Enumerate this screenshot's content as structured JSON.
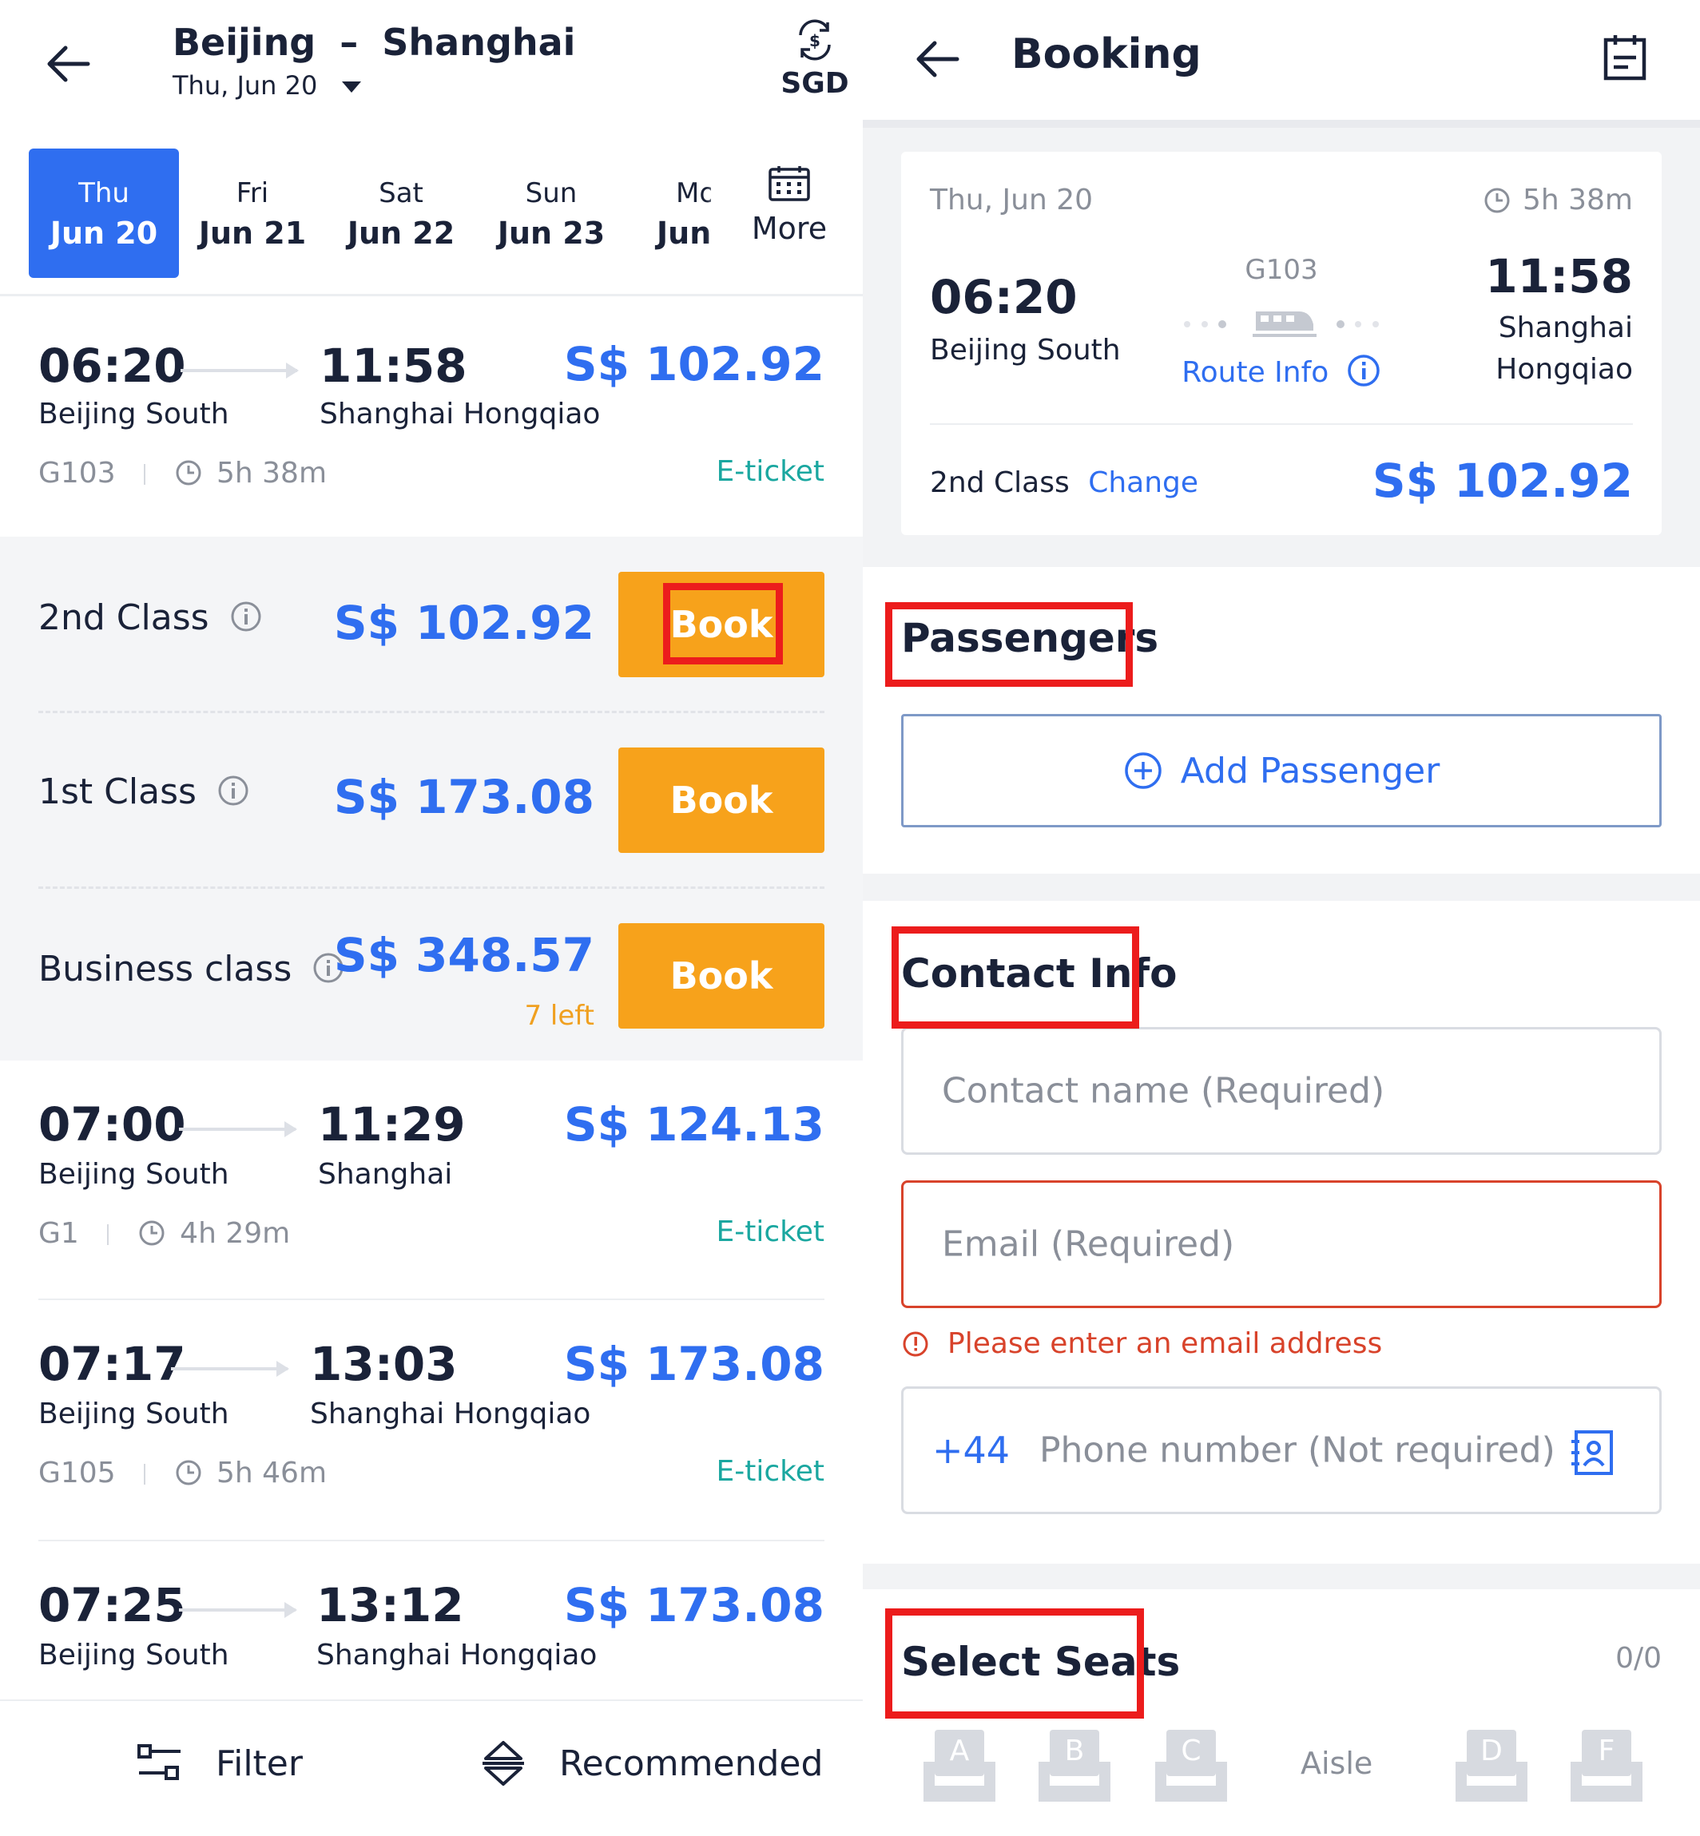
{
  "left": {
    "route_from": "Beijing",
    "route_sep": "–",
    "route_to": "Shanghai",
    "date": "Thu, Jun 20",
    "currency": "SGD",
    "date_tabs": [
      {
        "dow": "Thu",
        "dm": "Jun 20",
        "active": true
      },
      {
        "dow": "Fri",
        "dm": "Jun 21",
        "active": false
      },
      {
        "dow": "Sat",
        "dm": "Jun 22",
        "active": false
      },
      {
        "dow": "Sun",
        "dm": "Jun 23",
        "active": false
      },
      {
        "dow": "Mo",
        "dm": "Jun",
        "active": false
      }
    ],
    "more_label": "More",
    "trains": [
      {
        "depart": "06:20",
        "from": "Beijing South",
        "arrive": "11:58",
        "to": "Shanghai Hongqiao",
        "price": "S$ 102.92",
        "code": "G103",
        "duration": "5h 38m",
        "ticket": "E-ticket"
      },
      {
        "depart": "07:00",
        "from": "Beijing South",
        "arrive": "11:29",
        "to": "Shanghai",
        "price": "S$ 124.13",
        "code": "G1",
        "duration": "4h 29m",
        "ticket": "E-ticket"
      },
      {
        "depart": "07:17",
        "from": "Beijing South",
        "arrive": "13:03",
        "to": "Shanghai Hongqiao",
        "price": "S$ 173.08",
        "code": "G105",
        "duration": "5h 46m",
        "ticket": "E-ticket"
      },
      {
        "depart": "07:25",
        "from": "Beijing South",
        "arrive": "13:12",
        "to": "Shanghai Hongqiao",
        "price": "S$ 173.08"
      }
    ],
    "classes": [
      {
        "name": "2nd Class",
        "price": "S$ 102.92",
        "book": "Book"
      },
      {
        "name": "1st Class",
        "price": "S$ 173.08",
        "book": "Book"
      },
      {
        "name": "Business class",
        "price": "S$ 348.57",
        "left": "7 left",
        "book": "Book"
      }
    ],
    "filter_label": "Filter",
    "sort_label": "Recommended"
  },
  "right": {
    "title": "Booking",
    "card": {
      "date": "Thu, Jun 20",
      "duration": "5h 38m",
      "depart": "06:20",
      "from": "Beijing South",
      "code": "G103",
      "route_info": "Route Info",
      "arrive": "11:58",
      "to_line1": "Shanghai",
      "to_line2": "Hongqiao",
      "class": "2nd Class",
      "change": "Change",
      "price": "S$ 102.92"
    },
    "passengers_title": "Passengers",
    "add_passenger": "Add Passenger",
    "contact_title": "Contact Info",
    "contact_name_placeholder": "Contact name (Required)",
    "email_placeholder": "Email (Required)",
    "email_error": "Please enter an email address",
    "phone_code": "+44",
    "phone_placeholder": "Phone number (Not required)",
    "seats_title": "Select Seats",
    "seats_count": "0/0",
    "seats": [
      "A",
      "B",
      "C",
      "D",
      "F"
    ],
    "aisle": "Aisle"
  },
  "colors": {
    "accent": "#2f6ef0",
    "book": "#f7a21b",
    "eticket": "#1aa7a0",
    "error": "#d8432b",
    "highlight": "#ec1c1c"
  }
}
